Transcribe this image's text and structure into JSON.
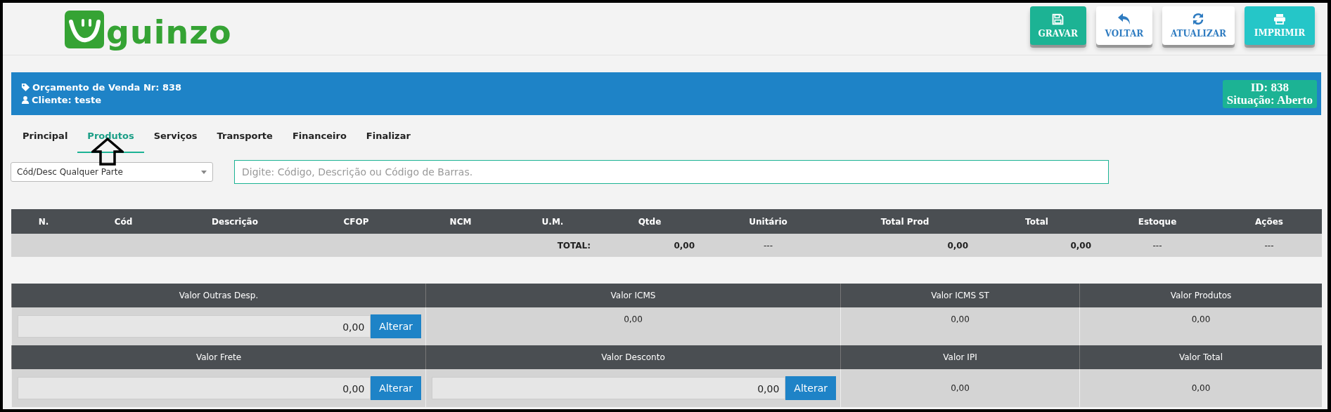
{
  "logo": {
    "text": "guinzo"
  },
  "toolbar": [
    {
      "label": "GRAVAR",
      "kind": "save"
    },
    {
      "label": "VOLTAR",
      "kind": "back"
    },
    {
      "label": "ATUALIZAR",
      "kind": "refresh"
    },
    {
      "label": "IMPRIMIR",
      "kind": "print"
    }
  ],
  "order_banner": {
    "title": "Orçamento de Venda Nr: 838",
    "client": "Cliente: teste",
    "id": "ID: 838",
    "status": "Situação: Aberto"
  },
  "tabs": [
    {
      "label": "Principal",
      "selected": false
    },
    {
      "label": "Produtos",
      "selected": true
    },
    {
      "label": "Serviços",
      "selected": false
    },
    {
      "label": "Transporte",
      "selected": false
    },
    {
      "label": "Financeiro",
      "selected": false
    },
    {
      "label": "Finalizar",
      "selected": false
    }
  ],
  "search": {
    "mode": "Cód/Desc Qualquer Parte",
    "placeholder": "Digite: Código, Descrição ou Código de Barras."
  },
  "items_table": {
    "columns": [
      "N.",
      "Cód",
      "Descrição",
      "CFOP",
      "NCM",
      "U.M.",
      "Qtde",
      "Unitário",
      "Total Prod",
      "Total",
      "Estoque",
      "Ações"
    ],
    "total_row": {
      "label": "TOTAL:",
      "qtde": "0,00",
      "unitario": "---",
      "total_prod": "0,00",
      "total": "0,00",
      "estoque": "---",
      "acoes": "---"
    }
  },
  "totals": [
    [
      {
        "label": "Valor Outras Desp.",
        "value": "0,00",
        "kind": "editable",
        "button": "Alterar"
      },
      {
        "label": "Valor ICMS",
        "value": "0,00",
        "kind": "readonly"
      },
      {
        "label": "Valor ICMS ST",
        "value": "0,00",
        "kind": "readonly"
      },
      {
        "label": "Valor Produtos",
        "value": "0,00",
        "kind": "readonly"
      }
    ],
    [
      {
        "label": "Valor Frete",
        "value": "0,00",
        "kind": "editable",
        "button": "Alterar"
      },
      {
        "label": "Valor Desconto",
        "value": "0,00",
        "kind": "editable",
        "button": "Alterar"
      },
      {
        "label": "Valor IPI",
        "value": "0,00",
        "kind": "readonly"
      },
      {
        "label": "Valor Total",
        "value": "0,00",
        "kind": "readonly"
      }
    ]
  ]
}
